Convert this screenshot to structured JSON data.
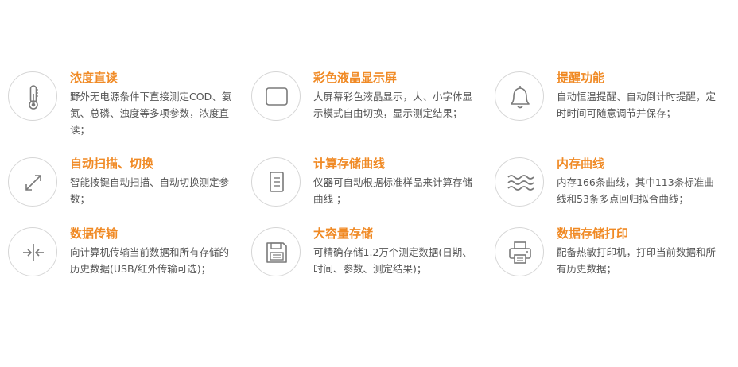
{
  "features": [
    {
      "title": "浓度直读",
      "desc": "野外无电源条件下直接测定COD、氨氮、总磷、浊度等多项参数，浓度直读；",
      "icon": "thermometer-icon"
    },
    {
      "title": "彩色液晶显示屏",
      "desc": "大屏幕彩色液晶显示，大、小字体显示模式自由切换，显示测定结果；",
      "icon": "screen-icon"
    },
    {
      "title": "提醒功能",
      "desc": "自动恒温提醒、自动倒计时提醒，定时时间可随意调节并保存；",
      "icon": "bell-icon"
    },
    {
      "title": "自动扫描、切换",
      "desc": "智能按键自动扫描、自动切换测定参数；",
      "icon": "expand-arrows-icon"
    },
    {
      "title": "计算存储曲线",
      "desc": "仪器可自动根据标准样品来计算存储曲线 ；",
      "icon": "document-icon"
    },
    {
      "title": "内存曲线",
      "desc": "内存166条曲线，其中113条标准曲线和53条多点回归拟合曲线；",
      "icon": "waves-icon"
    },
    {
      "title": "数据传输",
      "desc": "向计算机传输当前数据和所有存储的历史数据(USB/红外传输可选)；",
      "icon": "transfer-arrows-icon"
    },
    {
      "title": "大容量存储",
      "desc": "可精确存储1.2万个测定数据(日期、时间、参数、测定结果)；",
      "icon": "floppy-disk-icon"
    },
    {
      "title": "数据存储打印",
      "desc": "配备热敏打印机，打印当前数据和所有历史数据；",
      "icon": "printer-icon"
    }
  ]
}
